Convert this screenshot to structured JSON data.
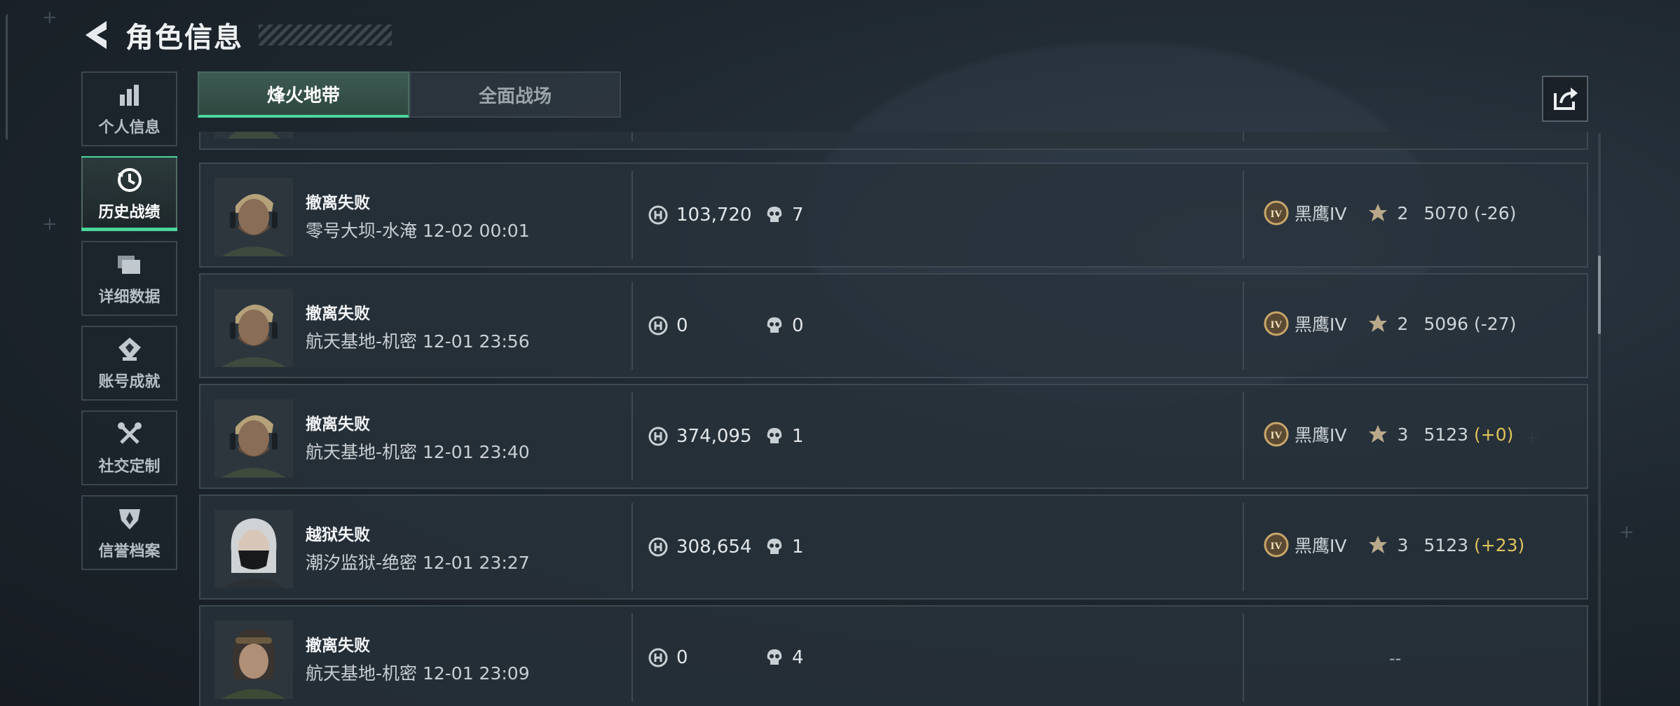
{
  "header": {
    "title": "角色信息"
  },
  "nav": [
    {
      "id": "personal",
      "label": "个人信息",
      "icon": "bar-chart-icon",
      "active": false
    },
    {
      "id": "history",
      "label": "历史战绩",
      "icon": "clock-history-icon",
      "active": true
    },
    {
      "id": "details",
      "label": "详细数据",
      "icon": "stack-cards-icon",
      "active": false
    },
    {
      "id": "achievements",
      "label": "账号成就",
      "icon": "achievement-badge-icon",
      "active": false
    },
    {
      "id": "social",
      "label": "社交定制",
      "icon": "tools-icon",
      "active": false
    },
    {
      "id": "credit",
      "label": "信誉档案",
      "icon": "shield-emblem-icon",
      "active": false
    }
  ],
  "tabs": [
    {
      "label": "烽火地带",
      "active": true
    },
    {
      "label": "全面战场",
      "active": false
    }
  ],
  "records": [
    {
      "result": "撤离失败",
      "map": "零号大坝-水淹 12-02 00:01",
      "coins": "103,720",
      "kills": "7",
      "rank": "黑鹰IV",
      "stars": "2",
      "score": "5070",
      "delta": "(-26)",
      "delta_positive": false,
      "avatar": "male-operator"
    },
    {
      "result": "撤离失败",
      "map": "航天基地-机密 12-01 23:56",
      "coins": "0",
      "kills": "0",
      "rank": "黑鹰IV",
      "stars": "2",
      "score": "5096",
      "delta": "(-27)",
      "delta_positive": false,
      "avatar": "male-operator"
    },
    {
      "result": "撤离失败",
      "map": "航天基地-机密 12-01 23:40",
      "coins": "374,095",
      "kills": "1",
      "rank": "黑鹰IV",
      "stars": "3",
      "score": "5123",
      "delta": "(+0)",
      "delta_positive": true,
      "avatar": "male-operator"
    },
    {
      "result": "越狱失败",
      "map": "潮汐监狱-绝密 12-01 23:27",
      "coins": "308,654",
      "kills": "1",
      "rank": "黑鹰IV",
      "stars": "3",
      "score": "5123",
      "delta": "(+23)",
      "delta_positive": true,
      "avatar": "masked-operator"
    },
    {
      "result": "撤离失败",
      "map": "航天基地-机密 12-01 23:09",
      "coins": "0",
      "kills": "4",
      "rank": null,
      "empty_rank": "--",
      "avatar": "female-operator"
    }
  ],
  "colors": {
    "accent": "#49d79c",
    "positive_delta": "#e0c45a",
    "rank_badge": "#c9a76a"
  }
}
